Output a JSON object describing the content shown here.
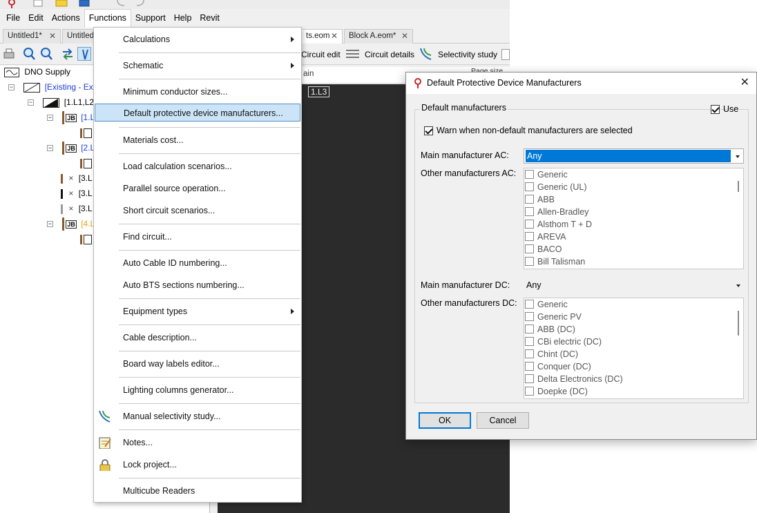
{
  "menubar": {
    "items": [
      "File",
      "Edit",
      "Actions",
      "Functions",
      "Support",
      "Help",
      "Revit"
    ]
  },
  "doc_tabs": [
    "Untitled1*",
    "Untitled",
    "ts.eom",
    "Block A.eom*"
  ],
  "toolbar": {
    "circuit_edit": "Circuit edit",
    "circuit_details": "Circuit details",
    "selectivity_study": "Selectivity study"
  },
  "header_strip": {
    "col1": "ain",
    "col2": "Page size"
  },
  "canvas": {
    "label": "1.L3"
  },
  "tree": {
    "root": "DNO Supply",
    "existing": "[Existing - Exc",
    "node": "[1.L1,L2",
    "children": [
      "[1.L",
      "[2.L",
      "[3.L",
      "[3.L",
      "[3.L",
      "[4.L"
    ],
    "jb": "JB"
  },
  "functions_menu": {
    "items": [
      {
        "label": "Calculations",
        "submenu": true
      },
      {
        "label": "Schematic",
        "submenu": true
      },
      {
        "label": "Minimum conductor sizes..."
      },
      {
        "label": "Default protective device manufacturers...",
        "highlighted": true
      },
      {
        "label": "Materials cost..."
      },
      {
        "label": "Load calculation scenarios..."
      },
      {
        "label": "Parallel source operation..."
      },
      {
        "label": "Short circuit scenarios..."
      },
      {
        "label": "Find circuit..."
      },
      {
        "label": "Auto Cable ID numbering..."
      },
      {
        "label": "Auto BTS sections numbering..."
      },
      {
        "label": "Equipment types",
        "submenu": true
      },
      {
        "label": "Cable description..."
      },
      {
        "label": "Board way labels editor..."
      },
      {
        "label": "Lighting columns generator..."
      },
      {
        "label": "Manual selectivity study...",
        "icon": "selectivity-icon"
      },
      {
        "label": "Notes...",
        "icon": "notes-icon"
      },
      {
        "label": "Lock project...",
        "icon": "lock-icon"
      },
      {
        "label": "Multicube Readers"
      }
    ]
  },
  "dialog": {
    "title": "Default Protective Device Manufacturers",
    "group_label": "Default manufacturers",
    "use_label": "Use",
    "use_checked": true,
    "warn_label": "Warn when non-default manufacturers are selected",
    "warn_checked": true,
    "main_ac_label": "Main manufacturer AC:",
    "main_ac_value": "Any",
    "other_ac_label": "Other manufacturers AC:",
    "other_ac_items": [
      "Generic",
      "Generic (UL)",
      "ABB",
      "Allen-Bradley",
      "Alsthom T + D",
      "AREVA",
      "BACO",
      "Bill Talisman"
    ],
    "main_dc_label": "Main manufacturer DC:",
    "main_dc_value": "Any",
    "other_dc_label": "Other manufacturers DC:",
    "other_dc_items": [
      "Generic",
      "Generic PV",
      "ABB (DC)",
      "CBi electric (DC)",
      "Chint (DC)",
      "Conquer (DC)",
      "Delta Electronics (DC)",
      "Doepke (DC)"
    ],
    "ok_label": "OK",
    "cancel_label": "Cancel"
  },
  "colors": {
    "accent": "#0078d7",
    "menu_highlight": "#cce4f7",
    "tree_link": "#1c3fd6",
    "tree_orange": "#e8a215"
  }
}
